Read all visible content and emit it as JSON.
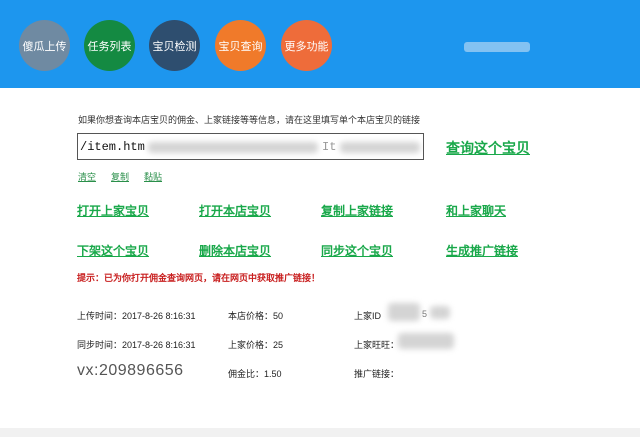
{
  "nav": {
    "items": [
      {
        "label": "傻瓜上传"
      },
      {
        "label": "任务列表"
      },
      {
        "label": "宝贝检测"
      },
      {
        "label": "宝贝查询"
      },
      {
        "label": "更多功能"
      }
    ]
  },
  "search": {
    "hint": "如果你想查询本店宝贝的佣金、上家链接等等信息，请在这里填写单个本店宝贝的链接",
    "url_value": "/item.htm",
    "url_tail": "It",
    "query_label": "查询这个宝贝",
    "tools": [
      "清空",
      "复制",
      "黏贴"
    ]
  },
  "actions": {
    "row1": [
      "打开上家宝贝",
      "打开本店宝贝",
      "复制上家链接",
      "和上家聊天"
    ],
    "row2": [
      "下架这个宝贝",
      "删除本店宝贝",
      "同步这个宝贝",
      "生成推广链接"
    ]
  },
  "warning": "提示：已为你打开佣金查询网页，请在网页中获取推广链接！",
  "info": {
    "upload_time": "上传时间：2017-8-26 8:16:31",
    "sync_time": "同步时间：2017-8-26 8:16:31",
    "store_price": "本店价格：50",
    "supplier_price": "上家价格：25",
    "commission": "佣金比：1.50",
    "supplier_id_label": "上家ID",
    "supplier_id_tail": "5",
    "supplier_ww_label": "上家旺旺：",
    "promo_link_label": "推广链接："
  },
  "watermark": "vx:209896656",
  "colors": {
    "header_bg": "#1d96ee",
    "link_green": "#19a84a",
    "warn_red": "#c81e1e"
  }
}
